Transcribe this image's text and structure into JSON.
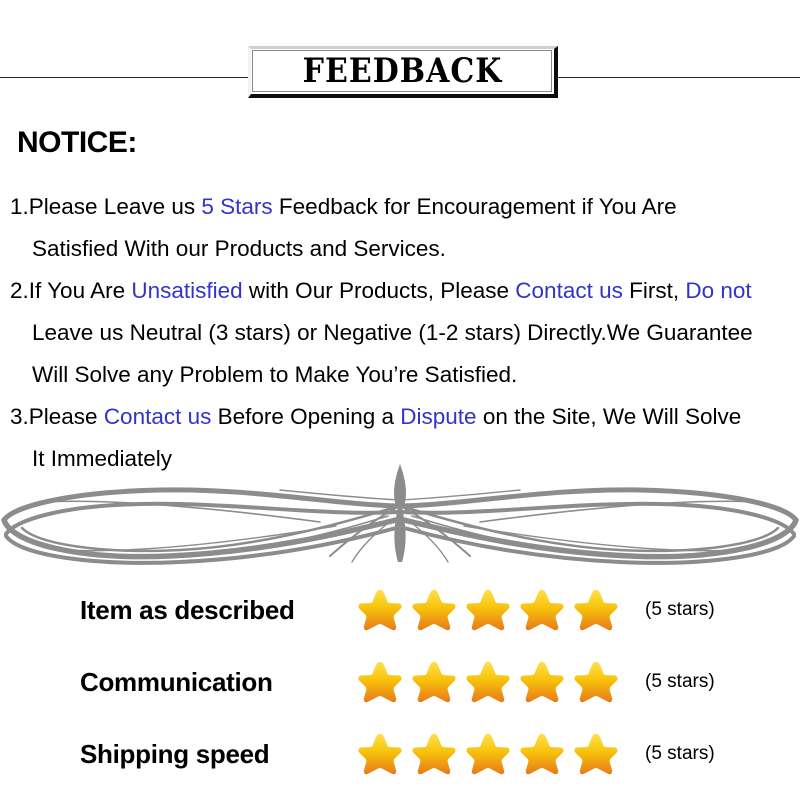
{
  "banner": {
    "title": "FEEDBACK"
  },
  "notice": {
    "heading": "NOTICE:"
  },
  "items": [
    {
      "lines": [
        [
          {
            "t": "1.Please Leave us ",
            "c": "black"
          },
          {
            "t": " 5 Stars ",
            "c": "blue"
          },
          {
            "t": " Feedback for  Encouragement  if You Are",
            "c": "black"
          }
        ],
        [
          {
            "t": "Satisfied With our Products and Services.",
            "c": "black"
          }
        ]
      ]
    },
    {
      "lines": [
        [
          {
            "t": "2.If You Are ",
            "c": "black"
          },
          {
            "t": "Unsatisfied",
            "c": "blue"
          },
          {
            "t": " with Our Products, Please ",
            "c": "black"
          },
          {
            "t": "Contact us",
            "c": "blue"
          },
          {
            "t": " First, ",
            "c": "black"
          },
          {
            "t": "Do not",
            "c": "blue"
          }
        ],
        [
          {
            "t": "Leave us Neutral (3 stars) or Negative (1-2 stars) Directly.We Guarantee",
            "c": "black"
          }
        ],
        [
          {
            "t": "Will Solve any Problem to Make You’re  Satisfied.",
            "c": "black"
          }
        ]
      ]
    },
    {
      "lines": [
        [
          {
            "t": "3.Please ",
            "c": "black"
          },
          {
            "t": "Contact us",
            "c": "blue"
          },
          {
            "t": " Before Opening a ",
            "c": "black"
          },
          {
            "t": "Dispute",
            "c": "blue"
          },
          {
            "t": " on the Site, We Will Solve",
            "c": "black"
          }
        ],
        [
          {
            "t": "It Immediately",
            "c": "black"
          }
        ]
      ]
    }
  ],
  "ratings": [
    {
      "label": "Item as described",
      "stars": 5,
      "count_text": "(5 stars)"
    },
    {
      "label": "Communication",
      "stars": 5,
      "count_text": "(5 stars)"
    },
    {
      "label": "Shipping speed",
      "stars": 5,
      "count_text": "(5 stars)"
    }
  ],
  "colors": {
    "link_blue": "#3333cc",
    "star_top": "#ffe14d",
    "star_mid": "#f7c20a",
    "star_bottom": "#e8791a",
    "ornament_gray": "#8c8c8c",
    "text_black": "#000000"
  }
}
